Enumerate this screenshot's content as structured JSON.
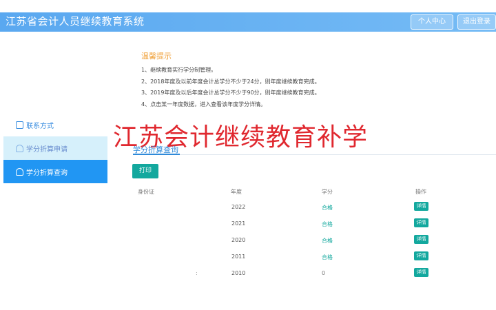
{
  "header": {
    "title": "江苏省会计人员继续教育系统",
    "home_button": "个人中心",
    "account_button": "退出登录"
  },
  "sidebar": {
    "items": [
      {
        "label": "联系方式",
        "icon": "contact-icon"
      },
      {
        "label": "学分折算申请",
        "icon": "apply-icon"
      },
      {
        "label": "学分折算查询",
        "icon": "query-icon"
      }
    ]
  },
  "notice": {
    "title": "温馨提示",
    "lines": [
      "1、继续教育实行学分制管理。",
      "2、2018年度及以前年度会计总学分不少于24分，则年度继续教育完成。",
      "3、2019年度及以后年度会计总学分不少于90分，则年度继续教育完成。",
      "4、点击某一年度数据，进入查看该年度学分详情。"
    ]
  },
  "watermark": "江苏会计继续教育补学",
  "query": {
    "section_title": "学分折算查询",
    "print_label": "打印",
    "columns": [
      "身份证",
      "年度",
      "学分",
      "操作"
    ],
    "rows": [
      {
        "year": "2022",
        "result": "合格",
        "action": "详情"
      },
      {
        "year": "2021",
        "result": "合格",
        "action": "详情"
      },
      {
        "year": "2020",
        "result": "合格",
        "action": "详情"
      },
      {
        "year": "2011",
        "result": "合格",
        "action": "详情"
      },
      {
        "year": "2010",
        "result": "0",
        "action": "详情",
        "id_mark": ":"
      }
    ]
  },
  "colors": {
    "header": "#5aa8f0",
    "active_menu": "#2196f3",
    "accent_teal": "#13a89e",
    "notice_title": "#f0a23c",
    "watermark": "#e0282f"
  }
}
